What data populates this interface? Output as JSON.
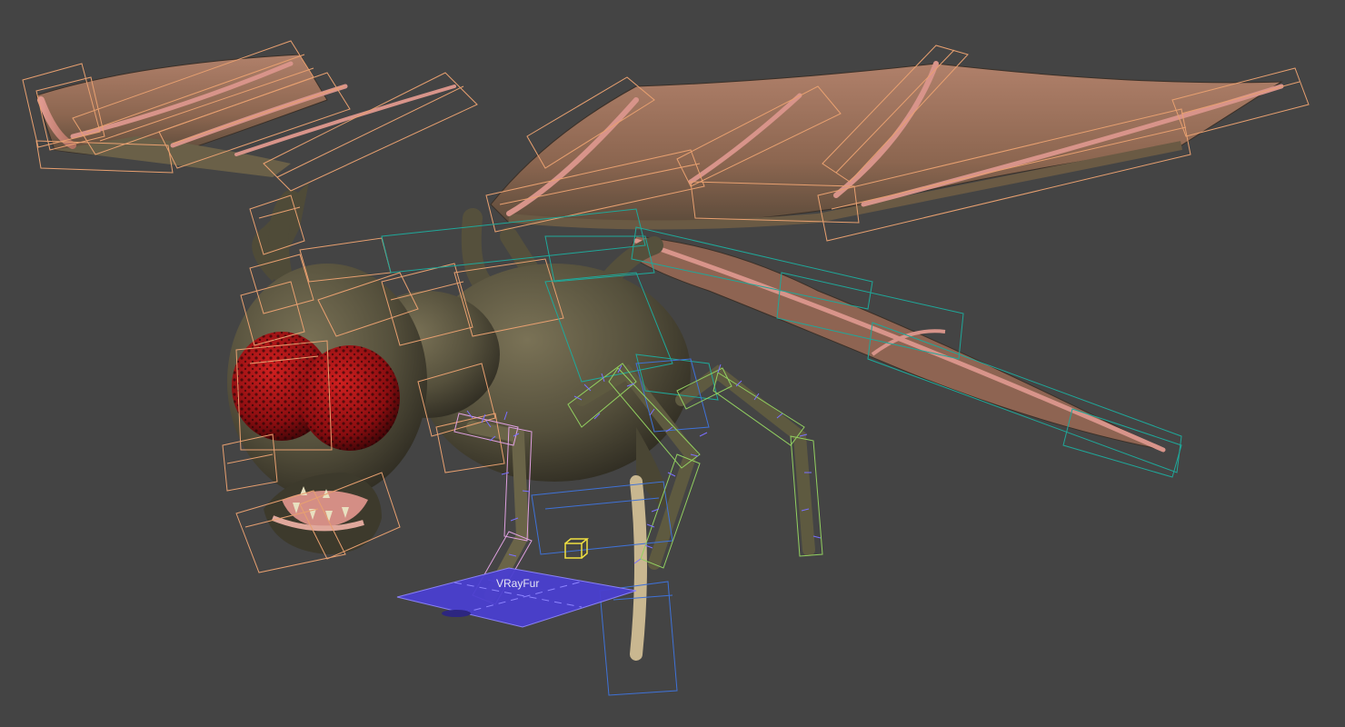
{
  "viewport": {
    "background": "#444444",
    "object_label": "VRayFur"
  },
  "colors": {
    "bone_orange": "#e8a070",
    "bone_teal": "#1fa89a",
    "bone_blue": "#3f72d8",
    "bone_green": "#92d060",
    "bone_pink": "#dfa0e0",
    "helper_yellow": "#f0e040",
    "plane_blue": "#4a3fd0",
    "wing_membrane": "#9a6a55",
    "body_skin": "#5e5a44",
    "eye_red": "#b11318"
  },
  "icons": [
    "vray-fur-plane-icon",
    "point-helper-icon"
  ]
}
